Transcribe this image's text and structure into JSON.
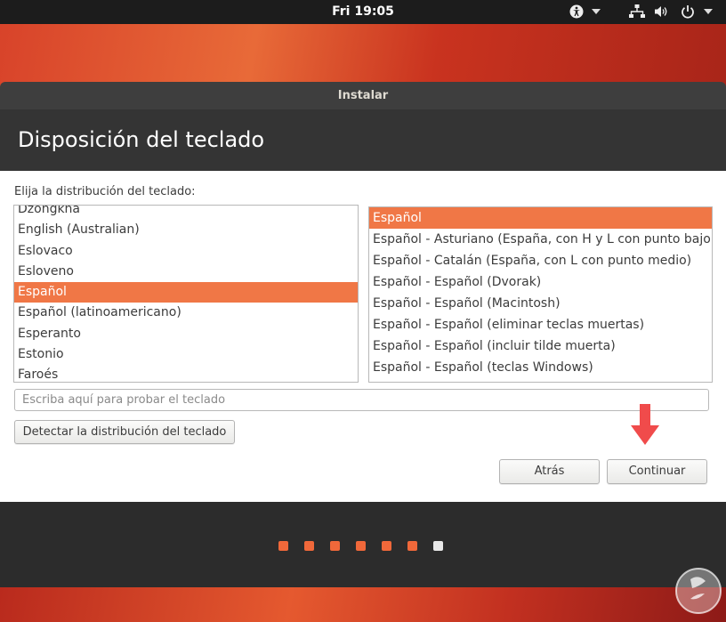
{
  "topbar": {
    "clock": "Fri 19:05",
    "icons": [
      "accessibility-icon",
      "network-icon",
      "volume-icon",
      "power-icon"
    ]
  },
  "window": {
    "title": "Instalar",
    "heading": "Disposición del teclado"
  },
  "layout_label": "Elija la distribución del teclado:",
  "languages": {
    "items": [
      "Dzongkha",
      "English (Australian)",
      "Eslovaco",
      "Esloveno",
      "Español",
      "Español (latinoamericano)",
      "Esperanto",
      "Estonio",
      "Faroés"
    ],
    "selected": "Español"
  },
  "variants": {
    "items": [
      "Español",
      "Español - Asturiano (España, con H y L con punto bajo)",
      "Español - Catalán (España, con L con punto medio)",
      "Español - Español (Dvorak)",
      "Español - Español (Macintosh)",
      "Español - Español (eliminar teclas muertas)",
      "Español - Español (incluir tilde muerta)",
      "Español - Español (teclas Windows)"
    ],
    "selected": "Español"
  },
  "test_input": {
    "placeholder": "Escriba aquí para probar el teclado",
    "value": ""
  },
  "buttons": {
    "detect": "Detectar la distribución del teclado",
    "back": "Atrás",
    "continue": "Continuar"
  },
  "progress": {
    "total_steps": 7,
    "current_step": 7
  },
  "colors": {
    "accent": "#f07746",
    "header_bg": "#343434",
    "footer_bg": "#2c2c2c",
    "arrow": "#f04b4b"
  }
}
